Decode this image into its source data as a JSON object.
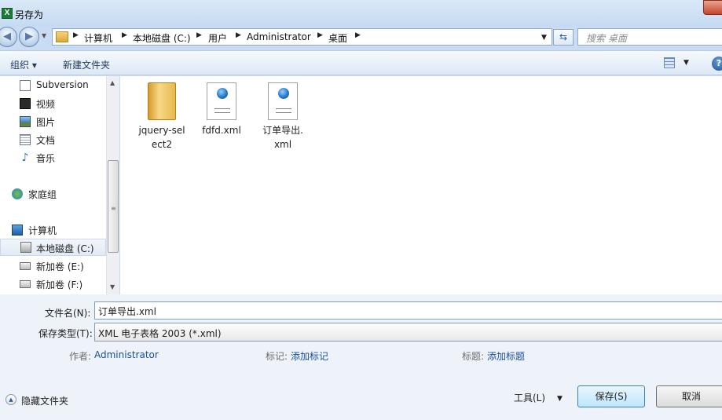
{
  "window": {
    "title": "另存为"
  },
  "address": {
    "crumbs": [
      "计算机",
      "本地磁盘 (C:)",
      "用户",
      "Administrator",
      "桌面"
    ],
    "search_placeholder": "搜索 桌面"
  },
  "toolbar": {
    "organize": "组织 ▾",
    "new_folder": "新建文件夹"
  },
  "nav": {
    "items": [
      {
        "label": "Subversion",
        "icon": "document-icon"
      },
      {
        "label": "视频",
        "icon": "video-icon"
      },
      {
        "label": "图片",
        "icon": "picture-icon"
      },
      {
        "label": "文档",
        "icon": "text-document-icon"
      },
      {
        "label": "音乐",
        "icon": "music-icon"
      },
      {
        "label": "家庭组",
        "icon": "homegroup-icon"
      },
      {
        "label": "计算机",
        "icon": "computer-icon"
      },
      {
        "label": "本地磁盘 (C:)",
        "icon": "system-drive-icon"
      },
      {
        "label": "新加卷 (E:)",
        "icon": "drive-icon"
      },
      {
        "label": "新加卷 (F:)",
        "icon": "drive-icon"
      }
    ]
  },
  "files": [
    {
      "name": "jquery-select2",
      "name_line1": "jquery-sel",
      "name_line2": "ect2",
      "type": "folder"
    },
    {
      "name": "fdfd.xml",
      "name_line1": "fdfd.xml",
      "name_line2": "",
      "type": "xml"
    },
    {
      "name": "订单导出.xml",
      "name_line1": "订单导出.",
      "name_line2": "xml",
      "type": "xml"
    }
  ],
  "form": {
    "filename_label": "文件名(N):",
    "filename_value": "订单导出.xml",
    "filetype_label": "保存类型(T):",
    "filetype_value": "XML 电子表格 2003 (*.xml)",
    "author_label": "作者:",
    "author_value": "Administrator",
    "tags_label": "标记:",
    "tags_value": "添加标记",
    "title_label": "标题:",
    "title_value": "添加标题"
  },
  "footer": {
    "hide_folders": "隐藏文件夹",
    "tools": "工具(L)",
    "save": "保存(S)",
    "cancel": "取消"
  }
}
